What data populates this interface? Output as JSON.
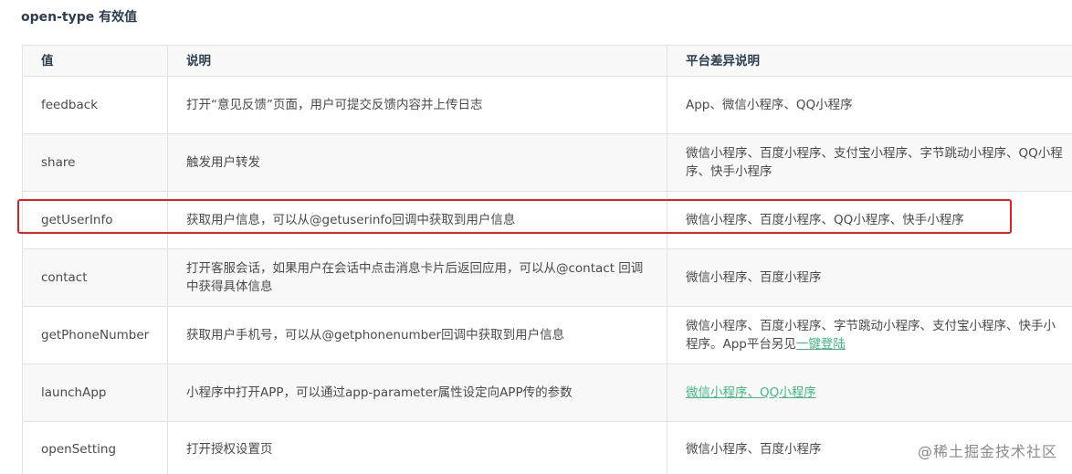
{
  "section_title": "open-type 有效值",
  "table": {
    "headers": [
      "值",
      "说明",
      "平台差异说明"
    ],
    "rows": [
      {
        "value": "feedback",
        "description": "打开“意见反馈”页面，用户可提交反馈内容并上传日志",
        "platform": "App、微信小程序、QQ小程序"
      },
      {
        "value": "share",
        "description": "触发用户转发",
        "platform": "微信小程序、百度小程序、支付宝小程序、字节跳动小程序、QQ小程序、快手小程序"
      },
      {
        "value": "getUserInfo",
        "description": "获取用户信息，可以从@getuserinfo回调中获取到用户信息",
        "platform": "微信小程序、百度小程序、QQ小程序、快手小程序"
      },
      {
        "value": "contact",
        "description": "打开客服会话，如果用户在会话中点击消息卡片后返回应用，可以从@contact 回调中获得具体信息",
        "platform": "微信小程序、百度小程序"
      },
      {
        "value": "getPhoneNumber",
        "description": "获取用户手机号，可以从@getphonenumber回调中获取到用户信息",
        "platform_text": "微信小程序、百度小程序、字节跳动小程序、支付宝小程序、快手小程序。App平台另见",
        "platform_link": "一键登陆"
      },
      {
        "value": "launchApp",
        "description": "小程序中打开APP，可以通过app-parameter属性设定向APP传的参数",
        "platform_link_1": "微信小程序",
        "platform_separator": "、",
        "platform_link_2": "QQ小程序"
      },
      {
        "value": "openSetting",
        "description": "打开授权设置页",
        "platform": "微信小程序、百度小程序"
      }
    ]
  },
  "watermark": "@稀土掘金技术社区",
  "colors": {
    "link": "#42b983",
    "highlight": "#e02020",
    "header_bg": "#f8f8f8",
    "border": "#e2e2e2"
  }
}
